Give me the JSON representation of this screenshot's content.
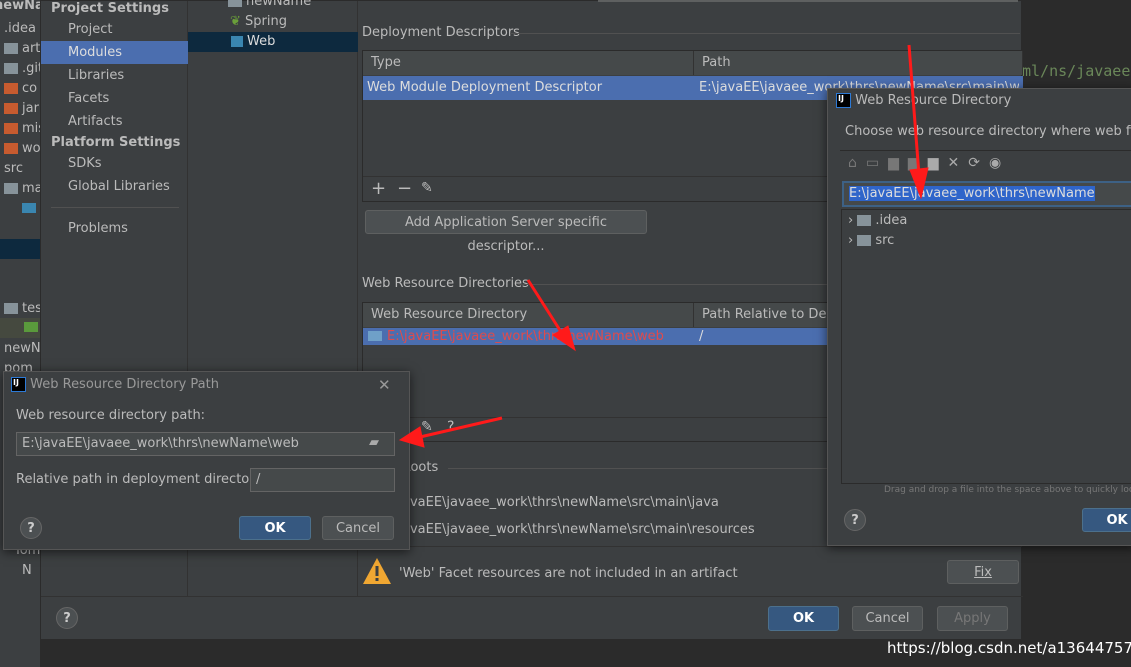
{
  "project_tree": {
    "root": "newName",
    "items": [
      ".idea",
      "art",
      ".git",
      "co",
      "jar",
      "mis",
      "wo",
      "src",
      "ma",
      "tes",
      "newN",
      "pom",
      "Tom",
      "N"
    ]
  },
  "editor": {
    "snippet": "ml/ns/javaee/w"
  },
  "settings": {
    "sidebar": {
      "project_heading": "Project Settings",
      "project_items": [
        "Project",
        "Modules",
        "Libraries",
        "Facets",
        "Artifacts"
      ],
      "platform_heading": "Platform Settings",
      "platform_items": [
        "SDKs",
        "Global Libraries"
      ],
      "problems": "Problems"
    },
    "module_tree": {
      "root": "newName",
      "items": [
        "Spring",
        "Web"
      ]
    },
    "deployment": {
      "title": "Deployment Descriptors",
      "columns": [
        "Type",
        "Path"
      ],
      "rows": [
        {
          "type": "Web Module Deployment Descriptor",
          "path": "E:\\javaEE\\javaee_work\\thrs\\newName\\src\\main\\web\\WE"
        }
      ],
      "add_server_button": "Add Application Server specific descriptor..."
    },
    "web_resources": {
      "title": "Web Resource Directories",
      "columns": [
        "Web Resource Directory",
        "Path Relative to Deplo"
      ],
      "rows": [
        {
          "dir": "E:\\javaEE\\javaee_work\\thrs\\newName\\web",
          "rel": "/"
        }
      ]
    },
    "source_roots": {
      "title": "Roots",
      "items": [
        "avaEE\\javaee_work\\thrs\\newName\\src\\main\\java",
        "avaEE\\javaee_work\\thrs\\newName\\src\\main\\resources"
      ]
    },
    "warning": {
      "text": "'Web' Facet resources are not included in an artifact",
      "fix_button": "Fix"
    },
    "footer": {
      "help": "?",
      "ok": "OK",
      "cancel": "Cancel",
      "apply": "Apply"
    }
  },
  "path_dialog": {
    "title": "Web Resource Directory Path",
    "path_label": "Web resource directory path:",
    "path_value": "E:\\javaEE\\javaee_work\\thrs\\newName\\web",
    "relative_label": "Relative path in deployment directory:",
    "relative_value": "/",
    "help": "?",
    "ok": "OK",
    "cancel": "Cancel"
  },
  "chooser_dialog": {
    "title": "Web Resource Directory",
    "description": "Choose web resource directory where web files w",
    "path_value": "E:\\javaEE\\javaee_work\\thrs\\newName",
    "tree": [
      ".idea",
      "src"
    ],
    "hint": "Drag and drop a file into the space above to quickly loca",
    "help": "?",
    "ok": "OK"
  },
  "watermark": "https://blog.csdn.net/a136447572",
  "colors": {
    "selection": "#4b6eaf",
    "error_text": "#e04b4b",
    "arrow": "#ff1a1a",
    "warning": "#f0a732"
  }
}
